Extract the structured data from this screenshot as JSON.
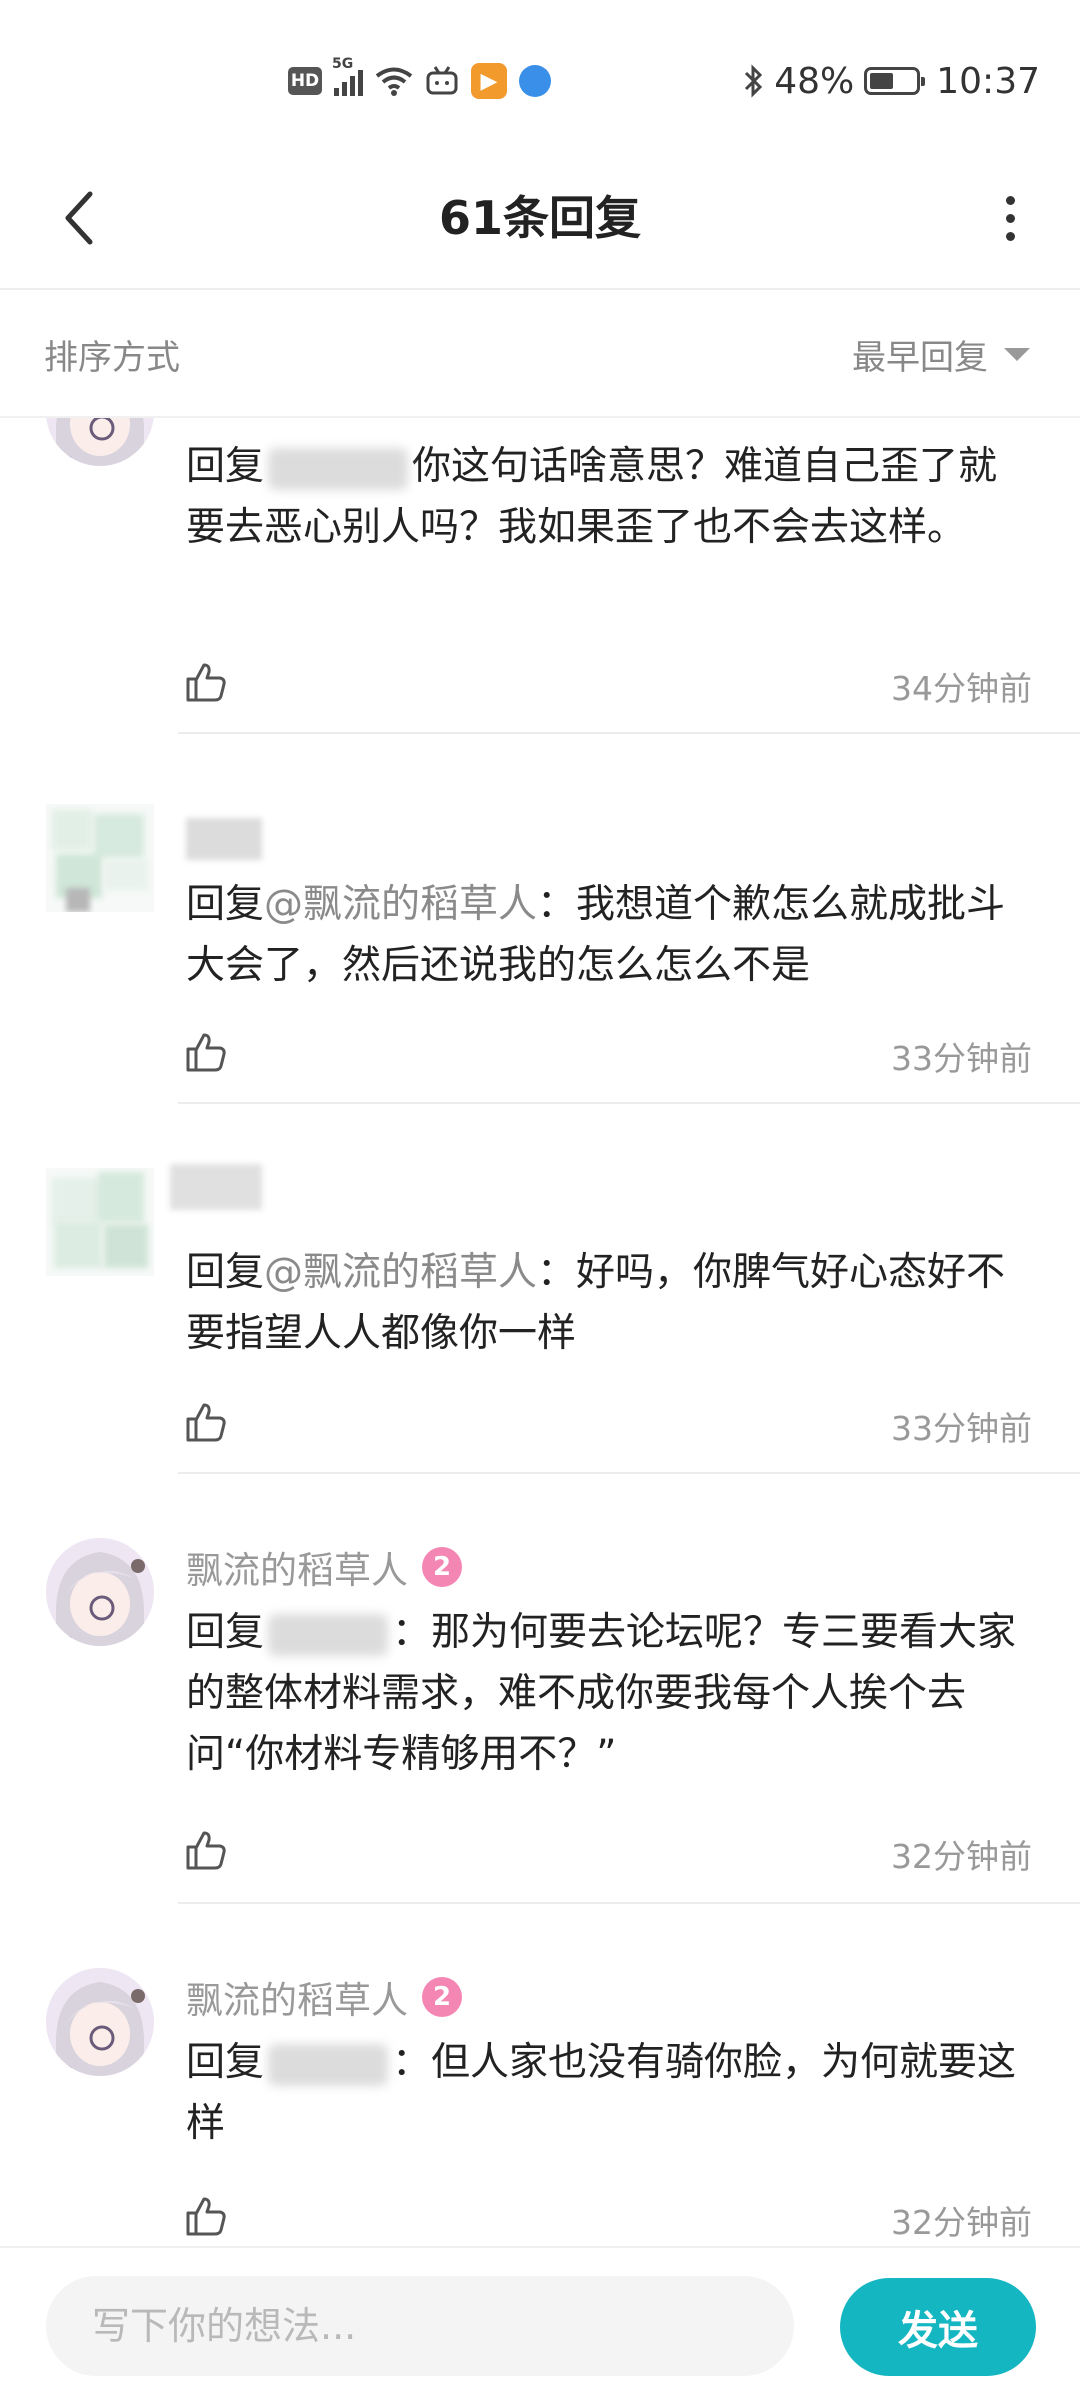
{
  "status_bar": {
    "hd": "HD",
    "network": "5G",
    "battery": "48%",
    "time": "10:37",
    "icons": [
      "hd-icon",
      "signal-icon",
      "wifi-icon",
      "bilibili-tv-icon",
      "video-app-icon",
      "globe-app-icon",
      "bluetooth-icon",
      "battery-icon"
    ]
  },
  "header": {
    "title": "61条回复"
  },
  "sort": {
    "label": "排序方式",
    "selected": "最早回复"
  },
  "comments": [
    {
      "username": "",
      "level": "",
      "reply_prefix": "回复",
      "mention": "",
      "text": "你这句话啥意思？难道自己歪了就要去恶心别人吗？我如果歪了也不会去这样。",
      "time": "34分钟前"
    },
    {
      "username": "",
      "level": "",
      "reply_prefix": "回复",
      "mention": "@飘流的稻草人",
      "text": "：我想道个歉怎么就成批斗大会了，然后还说我的怎么怎么不是",
      "time": "33分钟前"
    },
    {
      "username": "",
      "level": "",
      "reply_prefix": "回复",
      "mention": "@飘流的稻草人",
      "text": "：好吗，你脾气好心态好不要指望人人都像你一样",
      "time": "33分钟前"
    },
    {
      "username": "飘流的稻草人",
      "level": "2",
      "reply_prefix": "回复",
      "mention": "",
      "text": "：那为何要去论坛呢？专三要看大家的整体材料需求，难不成你要我每个人挨个去问“你材料专精够用不？”",
      "time": "32分钟前"
    },
    {
      "username": "飘流的稻草人",
      "level": "2",
      "reply_prefix": "回复",
      "mention": "",
      "text": "：但人家也没有骑你脸，为何就要这样",
      "time": "32分钟前"
    }
  ],
  "composer": {
    "placeholder": "写下你的想法...",
    "send_label": "发送"
  },
  "colors": {
    "accent": "#14b6c2",
    "level_badge": "#f486b4",
    "muted_text": "#999999"
  }
}
